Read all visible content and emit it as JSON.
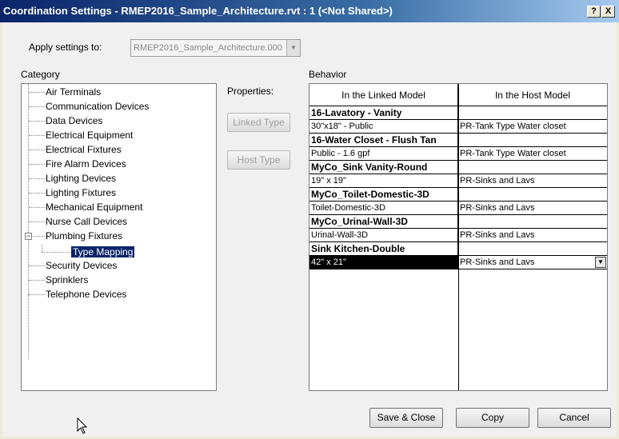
{
  "window": {
    "title": "Coordination Settings - RMEP2016_Sample_Architecture.rvt : 1 (<Not Shared>)",
    "help_label": "?",
    "close_label": "X"
  },
  "apply": {
    "label": "Apply settings to:",
    "value": "RMEP2016_Sample_Architecture.000",
    "arrow": "▼"
  },
  "category": {
    "label": "Category",
    "items": [
      "Air Terminals",
      "Communication Devices",
      "Data Devices",
      "Electrical Equipment",
      "Electrical Fixtures",
      "Fire Alarm Devices",
      "Lighting Devices",
      "Lighting Fixtures",
      "Mechanical Equipment",
      "Nurse Call Devices",
      "Plumbing Fixtures",
      "Type Mapping",
      "Security Devices",
      "Sprinklers",
      "Telephone Devices"
    ],
    "expander": "−"
  },
  "properties": {
    "label": "Properties:",
    "linked_type": "Linked Type",
    "host_type": "Host Type"
  },
  "behavior": {
    "label": "Behavior",
    "col_linked": "In the Linked Model",
    "col_host": "In the Host Model",
    "rows": [
      {
        "linked": "16-Lavatory - Vanity",
        "host": "",
        "family": true
      },
      {
        "linked": "30\"x18\" - Public",
        "host": "PR-Tank Type Water closet",
        "family": false
      },
      {
        "linked": "16-Water Closet - Flush Tan",
        "host": "",
        "family": true
      },
      {
        "linked": "Public - 1.6 gpf",
        "host": "PR-Tank Type Water closet",
        "family": false
      },
      {
        "linked": "MyCo_Sink Vanity-Round",
        "host": "",
        "family": true
      },
      {
        "linked": "19\" x 19\"",
        "host": "PR-Sinks and Lavs",
        "family": false
      },
      {
        "linked": "MyCo_Toilet-Domestic-3D",
        "host": "",
        "family": true
      },
      {
        "linked": "Toilet-Domestic-3D",
        "host": "PR-Sinks and Lavs",
        "family": false
      },
      {
        "linked": "MyCo_Urinal-Wall-3D",
        "host": "",
        "family": true
      },
      {
        "linked": "Urinal-Wall-3D",
        "host": "PR-Sinks and Lavs",
        "family": false
      },
      {
        "linked": "Sink Kitchen-Double",
        "host": "",
        "family": true
      },
      {
        "linked": "42\" x 21\"",
        "host": "PR-Sinks and Lavs",
        "family": false
      }
    ],
    "dropdown_arrow": "▼"
  },
  "buttons": {
    "save_close": "Save & Close",
    "copy": "Copy",
    "cancel": "Cancel"
  }
}
